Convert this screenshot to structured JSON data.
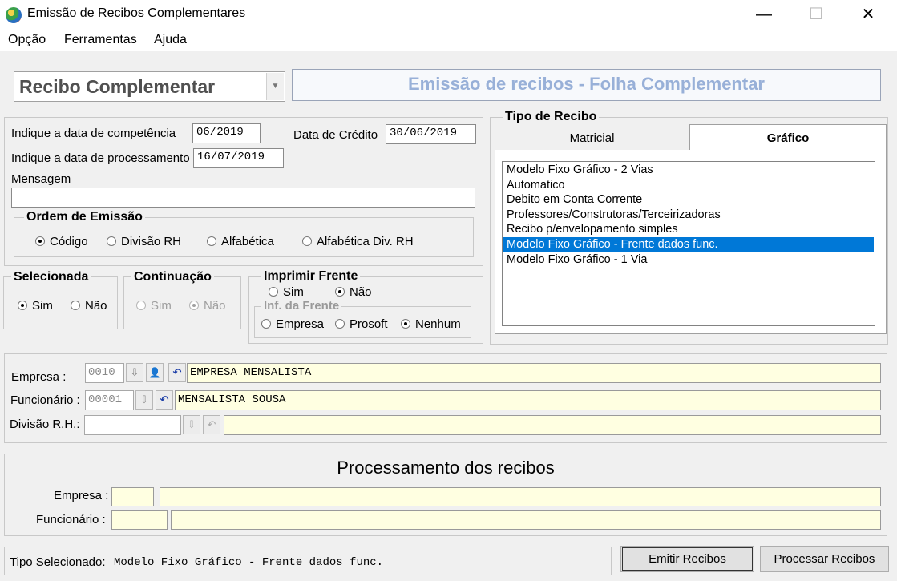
{
  "window": {
    "title": "Emissão de Recibos Complementares",
    "min_glyph": "—",
    "max_glyph": "☐",
    "close_glyph": "✕"
  },
  "menu": [
    "Opção",
    "Ferramentas",
    "Ajuda"
  ],
  "combo": {
    "value": "Recibo Complementar"
  },
  "header": "Emissão de recibos - Folha Complementar",
  "form": {
    "competencia_label": "Indique a data de competência",
    "competencia_value": "06/2019",
    "credito_label": "Data de Crédito",
    "credito_value": "30/06/2019",
    "processamento_label": "Indique a data de processamento",
    "processamento_value": "16/07/2019",
    "mensagem_label": "Mensagem",
    "mensagem_value": ""
  },
  "ordem": {
    "title": "Ordem de Emissão",
    "options": [
      "Código",
      "Divisão RH",
      "Alfabética",
      "Alfabética Div. RH"
    ],
    "selected": 0
  },
  "selecionada": {
    "title": "Selecionada",
    "sim": "Sim",
    "nao": "Não",
    "selected": "sim"
  },
  "continuacao": {
    "title": "Continuação",
    "sim": "Sim",
    "nao": "Não",
    "selected": "nao",
    "disabled": true
  },
  "imprimir_frente": {
    "title": "Imprimir Frente",
    "sim": "Sim",
    "nao": "Não",
    "selected": "nao",
    "inf_title": "Inf. da Frente",
    "inf_options": [
      "Empresa",
      "Prosoft",
      "Nenhum"
    ],
    "inf_selected": 2
  },
  "tipo_recibo": {
    "title": "Tipo de Recibo",
    "tabs": [
      "Matricial",
      "Gráfico"
    ],
    "active_tab": 1,
    "items": [
      "Modelo Fixo Gráfico - 2 Vias",
      "Automatico",
      "Debito em Conta Corrente",
      "Professores/Construtoras/Terceirizadoras",
      "Recibo p/envelopamento simples",
      "Modelo Fixo Gráfico - Frente dados func.",
      "Modelo Fixo Gráfico - 1 Via"
    ],
    "selected_index": 5
  },
  "empresa": {
    "label": "Empresa :",
    "code": "0010",
    "name": "EMPRESA MENSALISTA",
    "download_icon": "⇩",
    "user_icon": "👤",
    "undo_icon": "↶"
  },
  "funcionario": {
    "label": "Funcionário :",
    "code": "00001",
    "name": "MENSALISTA SOUSA"
  },
  "divisao": {
    "label": "Divisão R.H.:",
    "code": "",
    "name": ""
  },
  "processamento": {
    "title": "Processamento dos recibos",
    "empresa_label": "Empresa :",
    "funcionario_label": "Funcionário :"
  },
  "status": {
    "label": "Tipo Selecionado:",
    "value": "Modelo Fixo Gráfico - Frente dados func."
  },
  "buttons": {
    "emitir": "Emitir Recibos",
    "processar": "Processar Recibos"
  },
  "colors": {
    "selection": "#0078d7",
    "header_text": "#98b0d8",
    "yellow_field": "#ffffe1"
  }
}
